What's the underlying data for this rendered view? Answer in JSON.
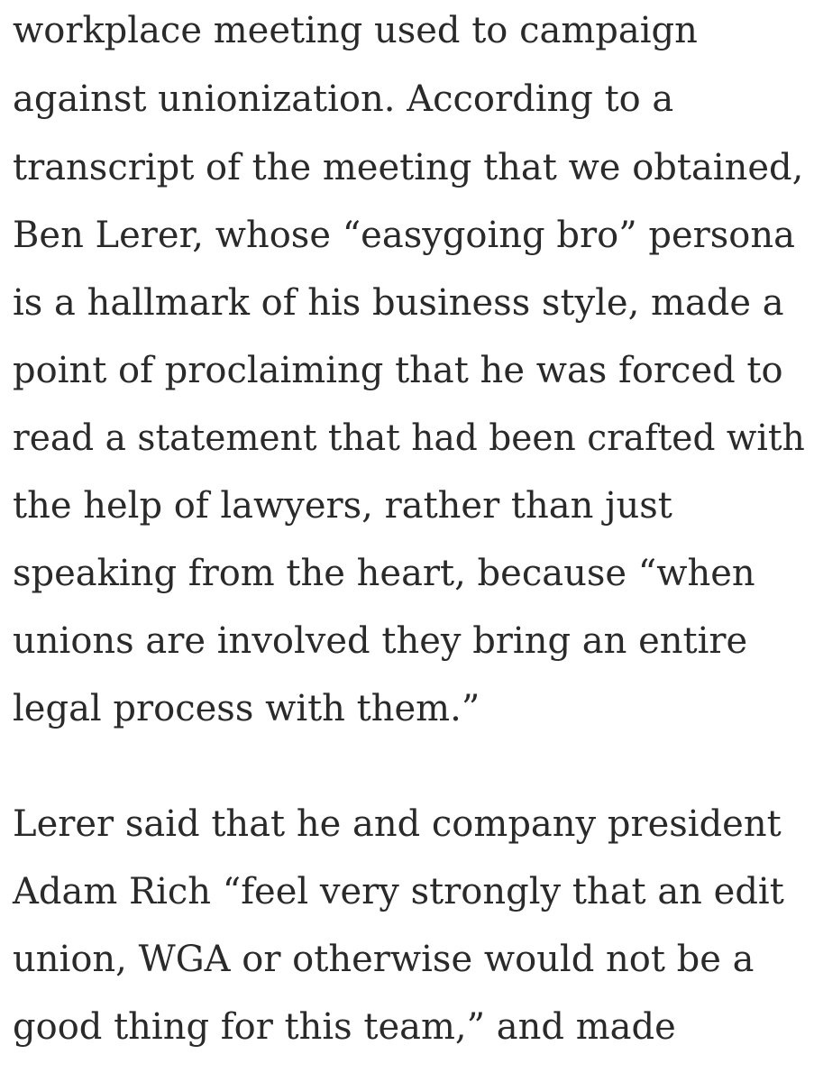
{
  "paragraph_1": {
    "lines": [
      "workplace meeting used to campaign",
      "against unionization. According to a",
      "transcript of the meeting that we obtained,",
      "Ben Lerer, whose “easygoing bro” persona",
      "is a hallmark of his business style, made a",
      "point of proclaiming that he was forced to",
      "read a statement that had been crafted with",
      "the help of lawyers, rather than just",
      "speaking from the heart, because “when",
      "unions are involved they bring an entire",
      "legal process with them.”"
    ]
  },
  "paragraph_2": {
    "lines": [
      "Lerer said that he and company president",
      "Adam Rich “feel very strongly that an edit",
      "union, WGA or otherwise would not be a",
      "good thing for this team,” and made"
    ]
  }
}
